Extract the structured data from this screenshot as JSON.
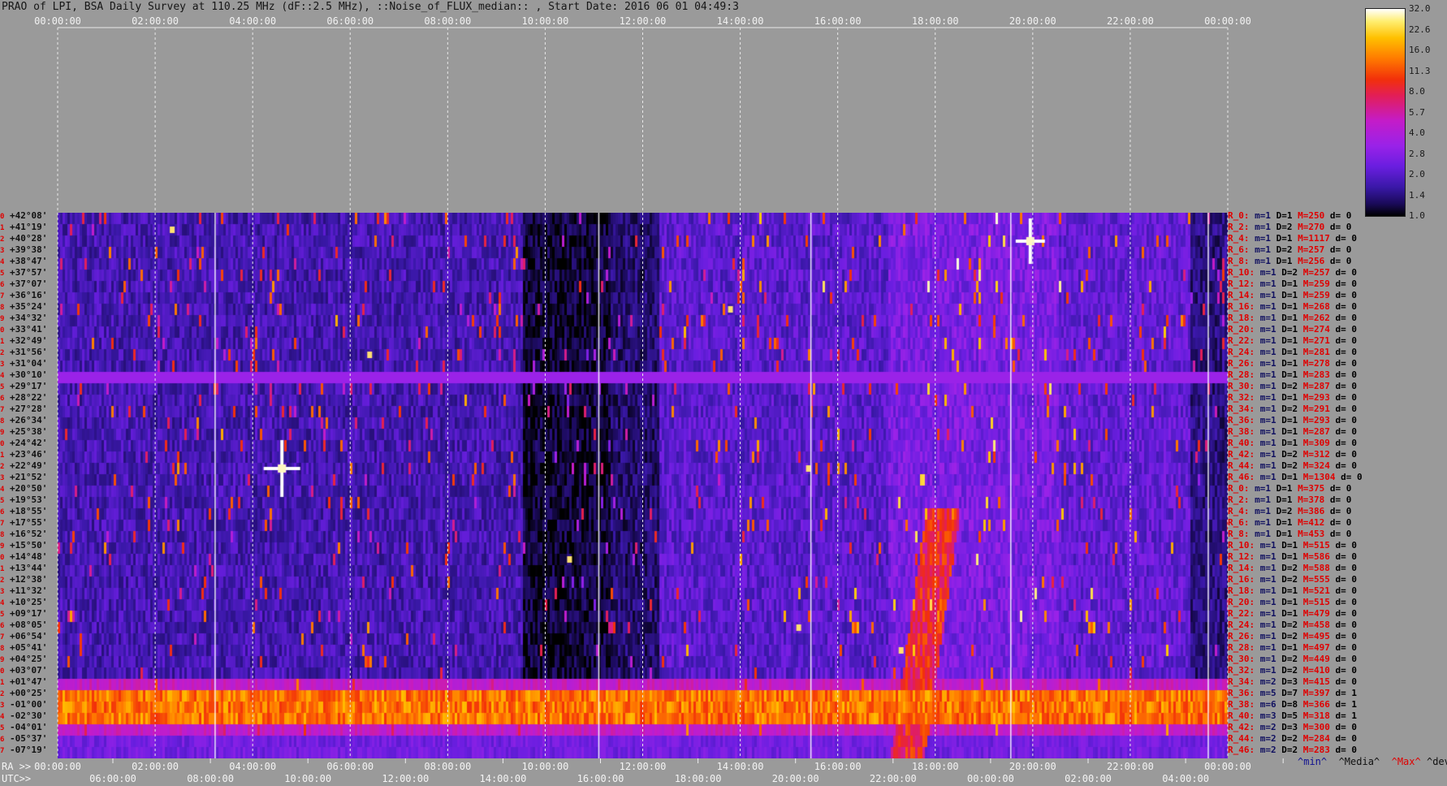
{
  "title": "PRAO of LPI, BSA Daily Survey at 110.25 MHz (dF::2.5 MHz), ::Noise_of_FLUX_median:: , Start Date: 2016 06 01 04:49:3",
  "top_axis_ticks": [
    "00:00:00",
    "02:00:00",
    "04:00:00",
    "06:00:00",
    "08:00:00",
    "10:00:00",
    "12:00:00",
    "14:00:00",
    "16:00:00",
    "18:00:00",
    "20:00:00",
    "22:00:00",
    "00:00:00"
  ],
  "colorbar": {
    "labels": [
      "32.0",
      "22.6",
      "16.0",
      "11.3",
      "8.0",
      "5.7",
      "4.0",
      "2.8",
      "2.0",
      "1.4",
      "1.0"
    ]
  },
  "declinations": [
    "+42°08'",
    "+41°19'",
    "+40°28'",
    "+39°38'",
    "+38°47'",
    "+37°57'",
    "+37°07'",
    "+36°16'",
    "+35°24'",
    "+34°32'",
    "+33°41'",
    "+32°49'",
    "+31°56'",
    "+31°04'",
    "+30°10'",
    "+29°17'",
    "+28°22'",
    "+27°28'",
    "+26°34'",
    "+25°38'",
    "+24°42'",
    "+23°46'",
    "+22°49'",
    "+21°52'",
    "+20°50'",
    "+19°53'",
    "+18°55'",
    "+17°55'",
    "+16°52'",
    "+15°50'",
    "+14°48'",
    "+13°44'",
    "+12°38'",
    "+11°32'",
    "+10°25'",
    "+09°17'",
    "+08°05'",
    "+06°54'",
    "+05°41'",
    "+04°25'",
    "+03°07'",
    "+01°47'",
    "+00°25'",
    "-01°00'",
    "-02°30'",
    "-04°01'",
    "-05°37'",
    "-07°19'"
  ],
  "ray_labels": [
    {
      "r": "R_0:",
      "m": "m=1",
      "d": "D=1",
      "h": "M=250",
      "dv": "d= 0"
    },
    {
      "r": "R_2:",
      "m": "m=1",
      "d": "D=2",
      "h": "M=270",
      "dv": "d= 0"
    },
    {
      "r": "R_4:",
      "m": "m=1",
      "d": "D=1",
      "h": "M=1117",
      "dv": "d= 0"
    },
    {
      "r": "R_6:",
      "m": "m=1",
      "d": "D=2",
      "h": "M=257",
      "dv": "d= 0"
    },
    {
      "r": "R_8:",
      "m": "m=1",
      "d": "D=1",
      "h": "M=256",
      "dv": "d= 0"
    },
    {
      "r": "R_10:",
      "m": "m=1",
      "d": "D=2",
      "h": "M=257",
      "dv": "d= 0"
    },
    {
      "r": "R_12:",
      "m": "m=1",
      "d": "D=1",
      "h": "M=259",
      "dv": "d= 0"
    },
    {
      "r": "R_14:",
      "m": "m=1",
      "d": "D=1",
      "h": "M=259",
      "dv": "d= 0"
    },
    {
      "r": "R_16:",
      "m": "m=1",
      "d": "D=1",
      "h": "M=268",
      "dv": "d= 0"
    },
    {
      "r": "R_18:",
      "m": "m=1",
      "d": "D=1",
      "h": "M=262",
      "dv": "d= 0"
    },
    {
      "r": "R_20:",
      "m": "m=1",
      "d": "D=1",
      "h": "M=274",
      "dv": "d= 0"
    },
    {
      "r": "R_22:",
      "m": "m=1",
      "d": "D=1",
      "h": "M=271",
      "dv": "d= 0"
    },
    {
      "r": "R_24:",
      "m": "m=1",
      "d": "D=1",
      "h": "M=281",
      "dv": "d= 0"
    },
    {
      "r": "R_26:",
      "m": "m=1",
      "d": "D=1",
      "h": "M=278",
      "dv": "d= 0"
    },
    {
      "r": "R_28:",
      "m": "m=1",
      "d": "D=1",
      "h": "M=283",
      "dv": "d= 0"
    },
    {
      "r": "R_30:",
      "m": "m=1",
      "d": "D=2",
      "h": "M=287",
      "dv": "d= 0"
    },
    {
      "r": "R_32:",
      "m": "m=1",
      "d": "D=1",
      "h": "M=293",
      "dv": "d= 0"
    },
    {
      "r": "R_34:",
      "m": "m=1",
      "d": "D=2",
      "h": "M=291",
      "dv": "d= 0"
    },
    {
      "r": "R_36:",
      "m": "m=1",
      "d": "D=1",
      "h": "M=293",
      "dv": "d= 0"
    },
    {
      "r": "R_38:",
      "m": "m=1",
      "d": "D=1",
      "h": "M=287",
      "dv": "d= 0"
    },
    {
      "r": "R_40:",
      "m": "m=1",
      "d": "D=1",
      "h": "M=309",
      "dv": "d= 0"
    },
    {
      "r": "R_42:",
      "m": "m=1",
      "d": "D=2",
      "h": "M=312",
      "dv": "d= 0"
    },
    {
      "r": "R_44:",
      "m": "m=1",
      "d": "D=2",
      "h": "M=324",
      "dv": "d= 0"
    },
    {
      "r": "R_46:",
      "m": "m=1",
      "d": "D=1",
      "h": "M=1304",
      "dv": "d= 0"
    },
    {
      "r": "R_0:",
      "m": "m=1",
      "d": "D=1",
      "h": "M=375",
      "dv": "d= 0"
    },
    {
      "r": "R_2:",
      "m": "m=1",
      "d": "D=1",
      "h": "M=378",
      "dv": "d= 0"
    },
    {
      "r": "R_4:",
      "m": "m=1",
      "d": "D=2",
      "h": "M=386",
      "dv": "d= 0"
    },
    {
      "r": "R_6:",
      "m": "m=1",
      "d": "D=1",
      "h": "M=412",
      "dv": "d= 0"
    },
    {
      "r": "R_8:",
      "m": "m=1",
      "d": "D=1",
      "h": "M=453",
      "dv": "d= 0"
    },
    {
      "r": "R_10:",
      "m": "m=1",
      "d": "D=1",
      "h": "M=515",
      "dv": "d= 0"
    },
    {
      "r": "R_12:",
      "m": "m=1",
      "d": "D=1",
      "h": "M=586",
      "dv": "d= 0"
    },
    {
      "r": "R_14:",
      "m": "m=1",
      "d": "D=2",
      "h": "M=588",
      "dv": "d= 0"
    },
    {
      "r": "R_16:",
      "m": "m=1",
      "d": "D=2",
      "h": "M=555",
      "dv": "d= 0"
    },
    {
      "r": "R_18:",
      "m": "m=1",
      "d": "D=1",
      "h": "M=521",
      "dv": "d= 0"
    },
    {
      "r": "R_20:",
      "m": "m=1",
      "d": "D=1",
      "h": "M=515",
      "dv": "d= 0"
    },
    {
      "r": "R_22:",
      "m": "m=1",
      "d": "D=1",
      "h": "M=479",
      "dv": "d= 0"
    },
    {
      "r": "R_24:",
      "m": "m=1",
      "d": "D=2",
      "h": "M=458",
      "dv": "d= 0"
    },
    {
      "r": "R_26:",
      "m": "m=1",
      "d": "D=2",
      "h": "M=495",
      "dv": "d= 0"
    },
    {
      "r": "R_28:",
      "m": "m=1",
      "d": "D=1",
      "h": "M=497",
      "dv": "d= 0"
    },
    {
      "r": "R_30:",
      "m": "m=1",
      "d": "D=2",
      "h": "M=449",
      "dv": "d= 0"
    },
    {
      "r": "R_32:",
      "m": "m=1",
      "d": "D=2",
      "h": "M=410",
      "dv": "d= 0"
    },
    {
      "r": "R_34:",
      "m": "m=2",
      "d": "D=3",
      "h": "M=415",
      "dv": "d= 0"
    },
    {
      "r": "R_36:",
      "m": "m=5",
      "d": "D=7",
      "h": "M=397",
      "dv": "d= 1"
    },
    {
      "r": "R_38:",
      "m": "m=6",
      "d": "D=8",
      "h": "M=366",
      "dv": "d= 1"
    },
    {
      "r": "R_40:",
      "m": "m=3",
      "d": "D=5",
      "h": "M=318",
      "dv": "d= 1"
    },
    {
      "r": "R_42:",
      "m": "m=2",
      "d": "D=3",
      "h": "M=300",
      "dv": "d= 0"
    },
    {
      "r": "R_44:",
      "m": "m=2",
      "d": "D=2",
      "h": "M=284",
      "dv": "d= 0"
    },
    {
      "r": "R_46:",
      "m": "m=2",
      "d": "D=2",
      "h": "M=283",
      "dv": "d= 0"
    }
  ],
  "ra_axis": {
    "prefix": "RA >>",
    "ticks": [
      "00:00:00",
      "02:00:00",
      "04:00:00",
      "06:00:00",
      "08:00:00",
      "10:00:00",
      "12:00:00",
      "14:00:00",
      "16:00:00",
      "18:00:00",
      "20:00:00",
      "22:00:00",
      "00:00:00"
    ]
  },
  "utc_axis": {
    "prefix": "UTC>>",
    "ticks": [
      "06:00:00",
      "08:00:00",
      "10:00:00",
      "12:00:00",
      "14:00:00",
      "16:00:00",
      "18:00:00",
      "20:00:00",
      "22:00:00",
      "00:00:00",
      "02:00:00",
      "04:00:00"
    ]
  },
  "legend": {
    "min": "^min^",
    "median": "^Media^",
    "max": "^Max^",
    "devia": "^devia^"
  },
  "colors": {
    "background": "#9a9a9a",
    "label_red": "#e00000"
  },
  "chart_data": {
    "type": "heatmap",
    "title": "PRAO of LPI, BSA Daily Survey at 110.25 MHz (dF::2.5 MHz), ::Noise_of_FLUX_median:: , Start Date: 2016 06 01 04:49:3",
    "x_axis": "RA 00:00:00 to 00:00:00 (24h)",
    "y_axis": "Declination +42°08' to -07°19' (48 rays)",
    "color_scale": "log",
    "color_range": [
      1.0,
      32.0
    ],
    "features": [
      {
        "kind": "bright source",
        "ra_hours": 4.6,
        "dec": "+22°49'"
      },
      {
        "kind": "bright source",
        "ra_hours": 19.95,
        "dec": "+40°28'"
      },
      {
        "kind": "band",
        "dec_range": [
          "+00°25'",
          "-02°30'"
        ]
      },
      {
        "kind": "horizontal line",
        "dec": "+29°17'"
      }
    ]
  }
}
